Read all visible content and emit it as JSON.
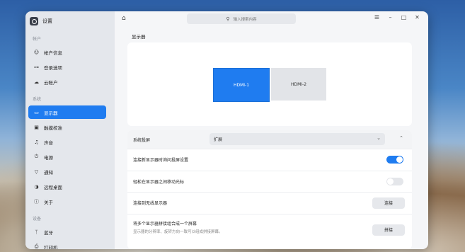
{
  "app": {
    "title": "设置"
  },
  "sidebar": {
    "groups": [
      {
        "label": "帐户",
        "items": [
          {
            "label": "帐户信息",
            "icon": "user-icon"
          },
          {
            "label": "登录选项",
            "icon": "key-icon"
          },
          {
            "label": "云帐户",
            "icon": "cloud-icon"
          }
        ]
      },
      {
        "label": "系统",
        "items": [
          {
            "label": "显示器",
            "icon": "monitor-icon",
            "active": true
          },
          {
            "label": "触摸校准",
            "icon": "touch-icon"
          },
          {
            "label": "声音",
            "icon": "speaker-icon"
          },
          {
            "label": "电源",
            "icon": "power-icon"
          },
          {
            "label": "通知",
            "icon": "bell-icon"
          },
          {
            "label": "远程桌面",
            "icon": "remote-desktop-icon"
          },
          {
            "label": "关于",
            "icon": "info-icon"
          }
        ]
      },
      {
        "label": "设备",
        "items": [
          {
            "label": "蓝牙",
            "icon": "bluetooth-icon"
          },
          {
            "label": "打印机",
            "icon": "printer-icon"
          }
        ]
      }
    ]
  },
  "search": {
    "placeholder": "输入搜索内容"
  },
  "main": {
    "section_title": "显示器",
    "monitors": [
      {
        "label": "HDMI-1",
        "primary": true
      },
      {
        "label": "HDMI-2",
        "primary": false
      }
    ],
    "projection": {
      "label": "系统投屏",
      "value": "扩展"
    },
    "rows": [
      {
        "label": "连接新显示器时询问投屏设置",
        "toggle": true
      },
      {
        "label": "轻松在显示器之间移动光标",
        "toggle": false
      },
      {
        "label": "连接到无线显示器",
        "button": "连接"
      },
      {
        "label": "将多个显示器拼接组合成一个屏幕",
        "sublabel": "显示器的分辨率、旋转方向一致可以组成拼接屏幕。",
        "button": "拼接"
      }
    ]
  },
  "colors": {
    "accent": "#1f7cf0"
  }
}
